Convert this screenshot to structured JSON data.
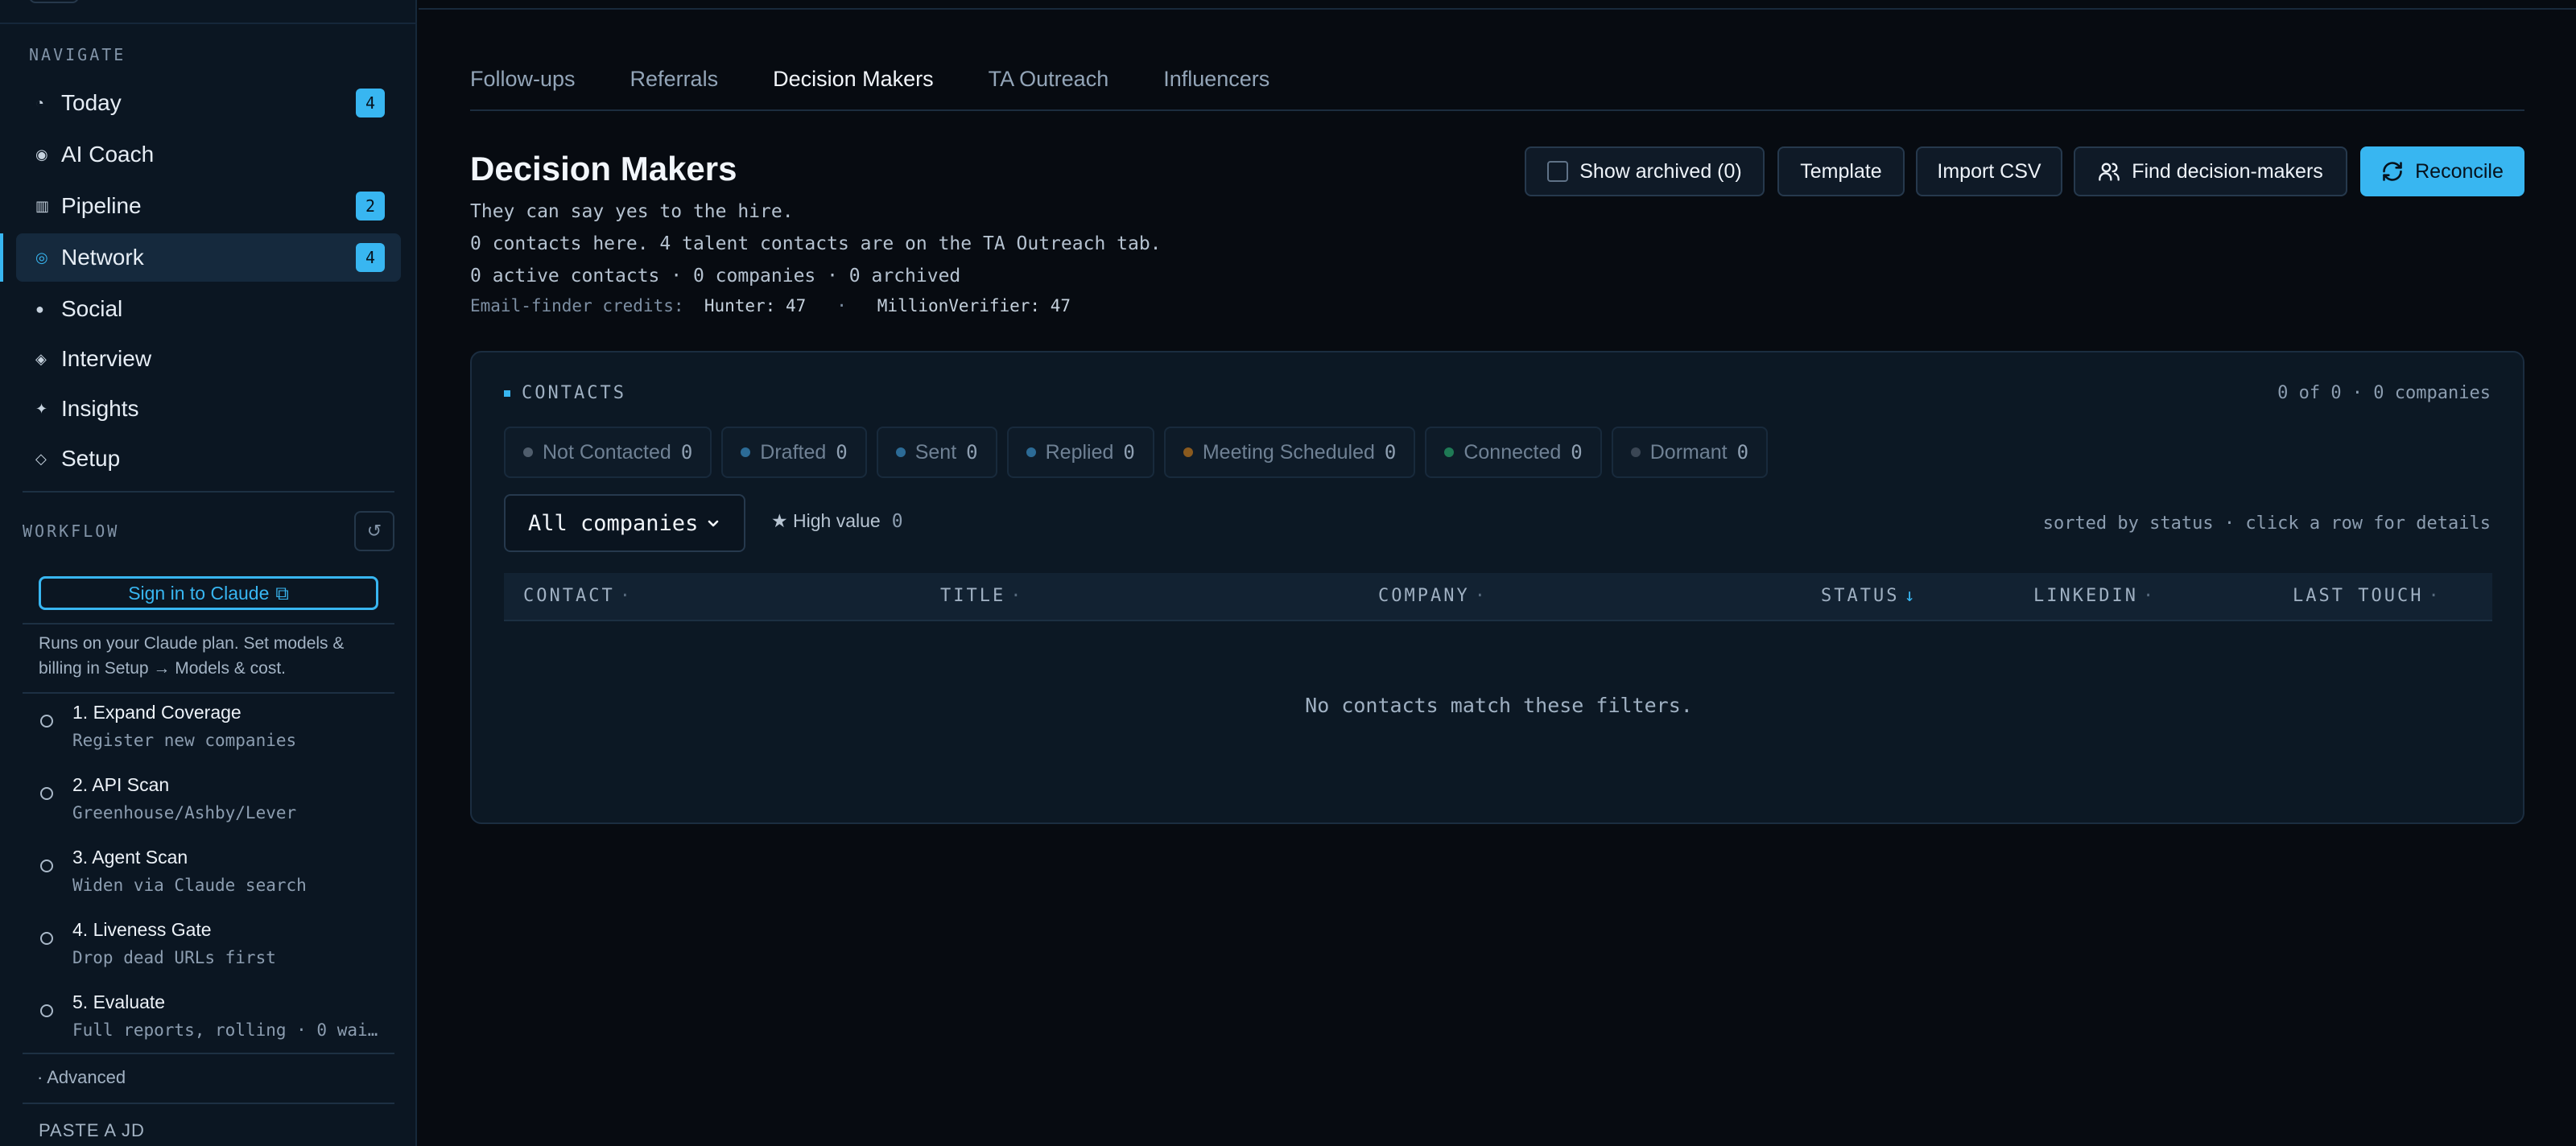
{
  "sidebar": {
    "navigate_heading": "NAVIGATE",
    "nav_items": [
      {
        "label": "Today",
        "icon": "◔",
        "badge": "4"
      },
      {
        "label": "AI Coach",
        "icon": "◉",
        "badge": ""
      },
      {
        "label": "Pipeline",
        "icon": "▥",
        "badge": "2"
      },
      {
        "label": "Network",
        "icon": "◎",
        "badge": "4"
      },
      {
        "label": "Social",
        "icon": "●",
        "badge": ""
      },
      {
        "label": "Interview",
        "icon": "◈",
        "badge": ""
      },
      {
        "label": "Insights",
        "icon": "✦",
        "badge": ""
      },
      {
        "label": "Setup",
        "icon": "◇",
        "badge": ""
      }
    ],
    "workflow_heading": "WORKFLOW",
    "reset_icon": "↺",
    "signin_label": "Sign in to Claude",
    "signin_icon": "⧉",
    "plan_note": "Runs on your Claude plan. Set models & billing in Setup → Models & cost.",
    "steps": [
      {
        "title": "1. Expand Coverage",
        "sub": "Register new companies"
      },
      {
        "title": "2. API Scan",
        "sub": "Greenhouse/Ashby/Lever"
      },
      {
        "title": "3. Agent Scan",
        "sub": "Widen via Claude search"
      },
      {
        "title": "4. Liveness Gate",
        "sub": "Drop dead URLs first"
      },
      {
        "title": "5. Evaluate",
        "sub": "Full reports, rolling · 0 wai…"
      }
    ],
    "advanced_label": "· Advanced",
    "paste_jd_label": "PASTE A JD"
  },
  "tabs": [
    "Follow-ups",
    "Referrals",
    "Decision Makers",
    "TA Outreach",
    "Influencers"
  ],
  "active_tab": "Decision Makers",
  "page": {
    "title": "Decision Makers",
    "tagline": "They can say yes to the hire.",
    "contacts_note": "0 contacts here. 4 talent contacts are on the TA Outreach tab.",
    "summary": "0 active contacts · 0 companies · 0 archived",
    "credits_label": "Email-finder credits:",
    "credits_hunter": "Hunter: 47",
    "credits_sep": "·",
    "credits_mv": "MillionVerifier: 47"
  },
  "actions": {
    "show_archived": "Show archived (0)",
    "template": "Template",
    "import_csv": "Import CSV",
    "find_dm": "Find decision-makers",
    "reconcile": "Reconcile"
  },
  "contacts": {
    "heading": "CONTACTS",
    "count": "0 of 0 · 0 companies",
    "statuses": [
      {
        "label": "Not Contacted",
        "count": "0",
        "color": "#4f5d6c"
      },
      {
        "label": "Drafted",
        "count": "0",
        "color": "#2c6b96"
      },
      {
        "label": "Sent",
        "count": "0",
        "color": "#2c6b96"
      },
      {
        "label": "Replied",
        "count": "0",
        "color": "#2c6b96"
      },
      {
        "label": "Meeting Scheduled",
        "count": "0",
        "color": "#8a5a1e"
      },
      {
        "label": "Connected",
        "count": "0",
        "color": "#1f7a55"
      },
      {
        "label": "Dormant",
        "count": "0",
        "color": "#3a4654"
      }
    ],
    "company_filter": "All companies",
    "high_value_label": "★ High value",
    "high_value_count": "0",
    "sort_hint": "sorted by status · click a row for details",
    "columns": [
      {
        "label": "CONTACT",
        "indicator": "·"
      },
      {
        "label": "TITLE",
        "indicator": "·"
      },
      {
        "label": "COMPANY",
        "indicator": "·"
      },
      {
        "label": "STATUS",
        "indicator": "↓"
      },
      {
        "label": "LINKEDIN",
        "indicator": "·"
      },
      {
        "label": "LAST TOUCH",
        "indicator": "·"
      }
    ],
    "empty_message": "No contacts match these filters."
  },
  "colors": {
    "accent": "#38b6f1",
    "background": "#070b11",
    "sidebar": "#0b1622",
    "card": "#0c1824"
  }
}
